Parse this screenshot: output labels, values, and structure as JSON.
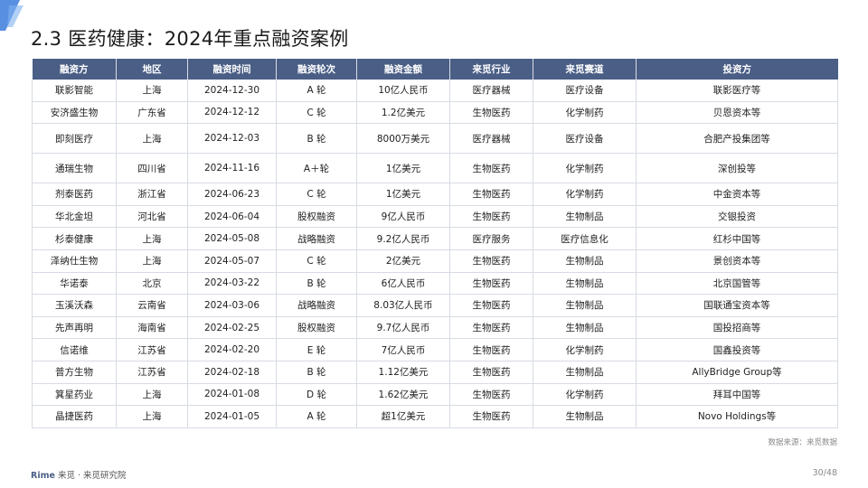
{
  "title": "2.3 医药健康：2024年重点融资案例",
  "table": {
    "headers": [
      "融资方",
      "地区",
      "融资时间",
      "融资轮次",
      "融资金额",
      "来觅行业",
      "来觅赛道",
      "投资方"
    ],
    "rows": [
      [
        "联影智能",
        "上海",
        "2024-12-30",
        "A 轮",
        "10亿人民币",
        "医疗器械",
        "医疗设备",
        "联影医疗等"
      ],
      [
        "安济盛生物",
        "广东省",
        "2024-12-12",
        "C 轮",
        "1.2亿美元",
        "生物医药",
        "化学制药",
        "贝恩资本等"
      ],
      [
        "即刻医疗",
        "上海",
        "2024-12-03",
        "B 轮",
        "8000万美元",
        "医疗器械",
        "医疗设备",
        "合肥产投集团等"
      ],
      [
        "通瑞生物",
        "四川省",
        "2024-11-16",
        "A＋轮",
        "1亿美元",
        "生物医药",
        "化学制药",
        "深创投等"
      ],
      [
        "剂泰医药",
        "浙江省",
        "2024-06-23",
        "C 轮",
        "1亿美元",
        "生物医药",
        "化学制药",
        "中金资本等"
      ],
      [
        "华北金坦",
        "河北省",
        "2024-06-04",
        "股权融资",
        "9亿人民币",
        "生物医药",
        "生物制品",
        "交银投资"
      ],
      [
        "杉泰健康",
        "上海",
        "2024-05-08",
        "战略融资",
        "9.2亿人民币",
        "医疗服务",
        "医疗信息化",
        "红杉中国等"
      ],
      [
        "泽纳仕生物",
        "上海",
        "2024-05-07",
        "C 轮",
        "2亿美元",
        "生物医药",
        "生物制品",
        "景创资本等"
      ],
      [
        "华诺泰",
        "北京",
        "2024-03-22",
        "B 轮",
        "6亿人民币",
        "生物医药",
        "生物制品",
        "北京国管等"
      ],
      [
        "玉溪沃森",
        "云南省",
        "2024-03-06",
        "战略融资",
        "8.03亿人民币",
        "生物医药",
        "生物制品",
        "国联通宝资本等"
      ],
      [
        "先声再明",
        "海南省",
        "2024-02-25",
        "股权融资",
        "9.7亿人民币",
        "生物医药",
        "生物制品",
        "国投招商等"
      ],
      [
        "信诺维",
        "江苏省",
        "2024-02-20",
        "E 轮",
        "7亿人民币",
        "生物医药",
        "化学制药",
        "国鑫投资等"
      ],
      [
        "普方生物",
        "江苏省",
        "2024-02-18",
        "B 轮",
        "1.12亿美元",
        "生物医药",
        "生物制品",
        "AllyBridge Group等"
      ],
      [
        "箕星药业",
        "上海",
        "2024-01-08",
        "D 轮",
        "1.62亿美元",
        "生物医药",
        "化学制药",
        "拜耳中国等"
      ],
      [
        "晶捷医药",
        "上海",
        "2024-01-05",
        "A 轮",
        "超1亿美元",
        "生物医药",
        "生物制品",
        "Novo Holdings等"
      ]
    ]
  },
  "source_note": "数据来源：来觅数据",
  "footer": {
    "brand_en": "Rime",
    "brand_cn": "来觅",
    "institute": "· 来觅研究院"
  },
  "page_number": "30/48",
  "colors": {
    "header_bg": "#4a5e86",
    "border": "#d7dbe3",
    "accent": "#3b7bdc"
  }
}
